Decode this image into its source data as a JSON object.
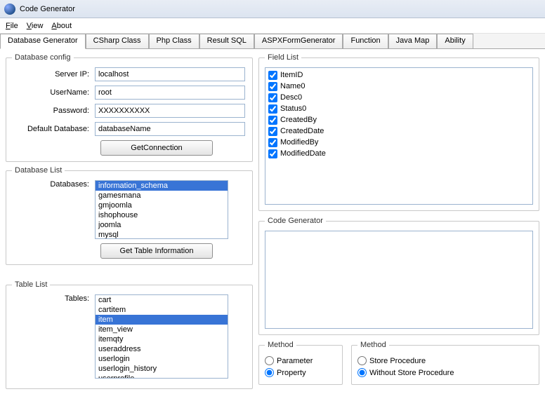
{
  "title": "Code Generator",
  "menu": {
    "file": "File",
    "view": "View",
    "about": "About"
  },
  "tabs": [
    "Database Generator",
    "CSharp Class",
    "Php Class",
    "Result SQL",
    "ASPXFormGenerator",
    "Function",
    "Java Map",
    "Ability"
  ],
  "activeTab": 0,
  "dbConfig": {
    "legend": "Database config",
    "serverIpLabel": "Server IP:",
    "serverIp": "localhost",
    "userNameLabel": "UserName:",
    "userName": "root",
    "passwordLabel": "Password:",
    "password": "XXXXXXXXXX",
    "defaultDbLabel": "Default Database:",
    "defaultDb": "databaseName",
    "getConnBtn": "GetConnection"
  },
  "dbList": {
    "legend": "Database List",
    "label": "Databases:",
    "items": [
      "information_schema",
      "gamesmana",
      "gmjoomla",
      "ishophouse",
      "joomla",
      "mysql"
    ],
    "selected": "information_schema",
    "getTableBtn": "Get Table Information"
  },
  "tableList": {
    "legend": "Table List",
    "label": "Tables:",
    "items": [
      "cart",
      "cartitem",
      "item",
      "item_view",
      "itemqty",
      "useraddress",
      "userlogin",
      "userlogin_history",
      "userprofile"
    ],
    "selected": "item"
  },
  "fieldList": {
    "legend": "Field List",
    "items": [
      "ItemID",
      "Name0",
      "Desc0",
      "Status0",
      "CreatedBy",
      "CreatedDate",
      "ModifiedBy",
      "ModifiedDate"
    ]
  },
  "codeGen": {
    "legend": "Code Generator"
  },
  "method1": {
    "legend": "Method",
    "opt1": "Parameter",
    "opt2": "Property",
    "selected": "Property"
  },
  "method2": {
    "legend": "Method",
    "opt1": "Store Procedure",
    "opt2": "Without Store Procedure",
    "selected": "Without Store Procedure"
  }
}
